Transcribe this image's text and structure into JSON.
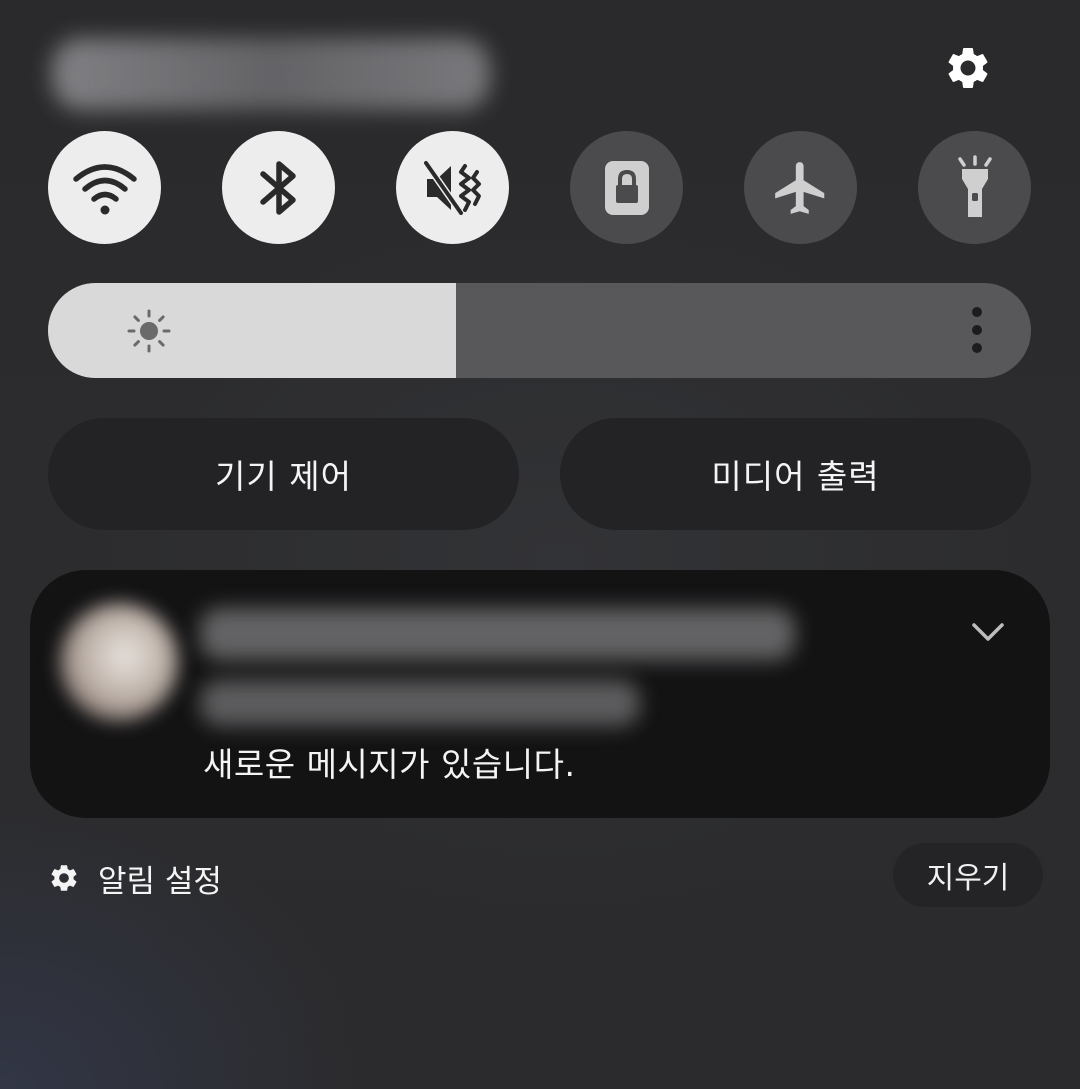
{
  "quick_settings": {
    "toggles": [
      {
        "name": "wifi-icon",
        "state": "on"
      },
      {
        "name": "bluetooth-icon",
        "state": "on"
      },
      {
        "name": "sound-mute-vibrate-icon",
        "state": "on"
      },
      {
        "name": "secure-folder-icon",
        "state": "off"
      },
      {
        "name": "airplane-icon",
        "state": "off"
      },
      {
        "name": "flashlight-icon",
        "state": "off"
      }
    ],
    "brightness_level": 0.415
  },
  "buttons": {
    "device_control": "기기 제어",
    "media_output": "미디어 출력"
  },
  "notification": {
    "message": "새로운 메시지가 있습니다."
  },
  "footer": {
    "notification_settings": "알림 설정",
    "clear": "지우기"
  },
  "colors": {
    "toggle_on": "#ededed",
    "toggle_off": "#4b4b4d",
    "brightness_fill": "#d9d9d9",
    "brightness_track": "#58585a"
  }
}
